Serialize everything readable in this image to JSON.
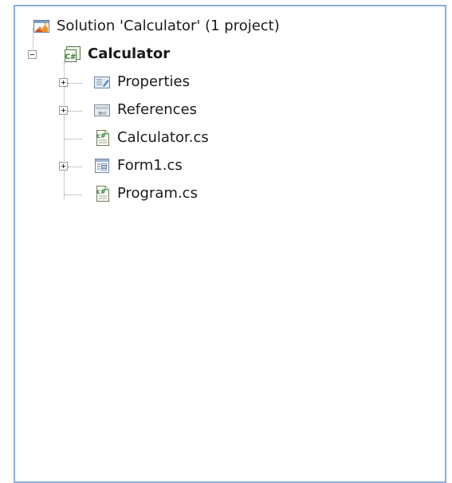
{
  "tree": {
    "solution": {
      "label": "Solution 'Calculator' (1 project)",
      "icon": "solution-icon"
    },
    "project": {
      "label": "Calculator",
      "icon": "csharp-project-icon",
      "expanded": true
    },
    "items": [
      {
        "label": "Properties",
        "icon": "properties-folder-icon",
        "expandable": true,
        "expanded": false
      },
      {
        "label": "References",
        "icon": "references-folder-icon",
        "expandable": true,
        "expanded": false
      },
      {
        "label": "Calculator.cs",
        "icon": "csharp-file-icon",
        "expandable": false
      },
      {
        "label": "Form1.cs",
        "icon": "form-icon",
        "expandable": true,
        "expanded": false
      },
      {
        "label": "Program.cs",
        "icon": "csharp-file-icon",
        "expandable": false
      }
    ]
  },
  "colors": {
    "border": "#8fb0d8",
    "connector": "#9a9a9a",
    "csharp": "#3a8a3a"
  }
}
